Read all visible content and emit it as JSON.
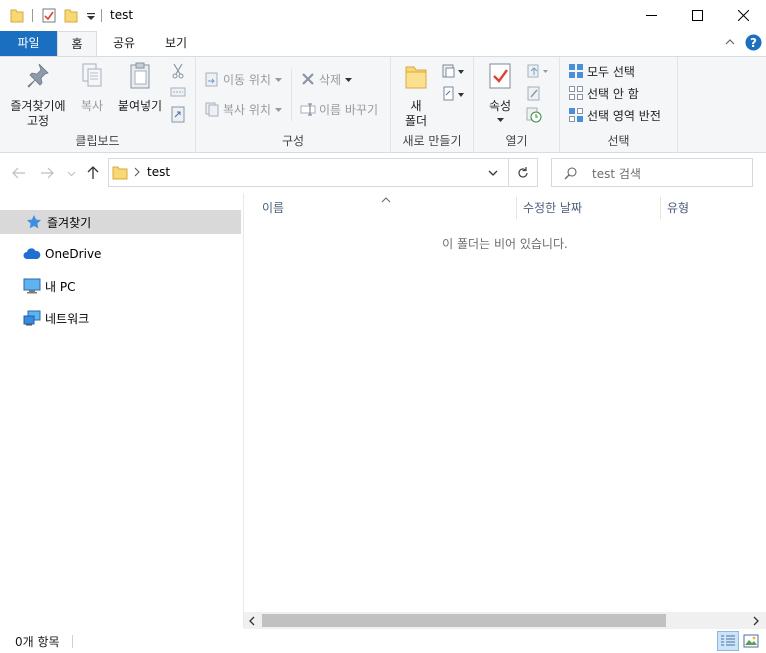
{
  "window": {
    "title": "test",
    "minimize_icon": "minimize-icon",
    "maximize_icon": "maximize-icon",
    "close_icon": "close-icon"
  },
  "quick_access": {
    "icons": [
      "folder-icon",
      "properties-check-icon",
      "new-folder-icon",
      "customize-dropdown-icon"
    ]
  },
  "ribbon_tabs": [
    "파일",
    "홈",
    "공유",
    "보기"
  ],
  "active_tab": "홈",
  "ribbon": {
    "clipboard": {
      "group_label": "클립보드",
      "pin_label": "즐겨찾기에\n고정",
      "copy_label": "복사",
      "paste_label": "붙여넣기"
    },
    "organize": {
      "group_label": "구성",
      "move_to": "이동 위치",
      "copy_to": "복사 위치",
      "delete": "삭제",
      "rename": "이름 바꾸기"
    },
    "new": {
      "group_label": "새로 만들기",
      "new_folder": "새\n폴더"
    },
    "open": {
      "group_label": "열기",
      "properties": "속성"
    },
    "select": {
      "group_label": "선택",
      "select_all": "모두 선택",
      "select_none": "선택 안 함",
      "invert_selection": "선택 영역 반전"
    }
  },
  "address_bar": {
    "path": "test",
    "search_placeholder": "test 검색"
  },
  "nav_pane": {
    "items": [
      {
        "label": "즐겨찾기",
        "icon": "star-icon",
        "selected": true
      },
      {
        "label": "OneDrive",
        "icon": "cloud-icon",
        "selected": false
      },
      {
        "label": "내 PC",
        "icon": "monitor-icon",
        "selected": false
      },
      {
        "label": "네트워크",
        "icon": "network-icon",
        "selected": false
      }
    ]
  },
  "content": {
    "columns": [
      "이름",
      "수정한 날짜",
      "유형"
    ],
    "empty_message": "이 폴더는 비어 있습니다."
  },
  "status": {
    "item_count": "0개 항목"
  },
  "colors": {
    "accent": "#1a6fc0",
    "help": "#1a6fc0",
    "folder": "#f8d775",
    "selection": "#d9d9d9"
  }
}
